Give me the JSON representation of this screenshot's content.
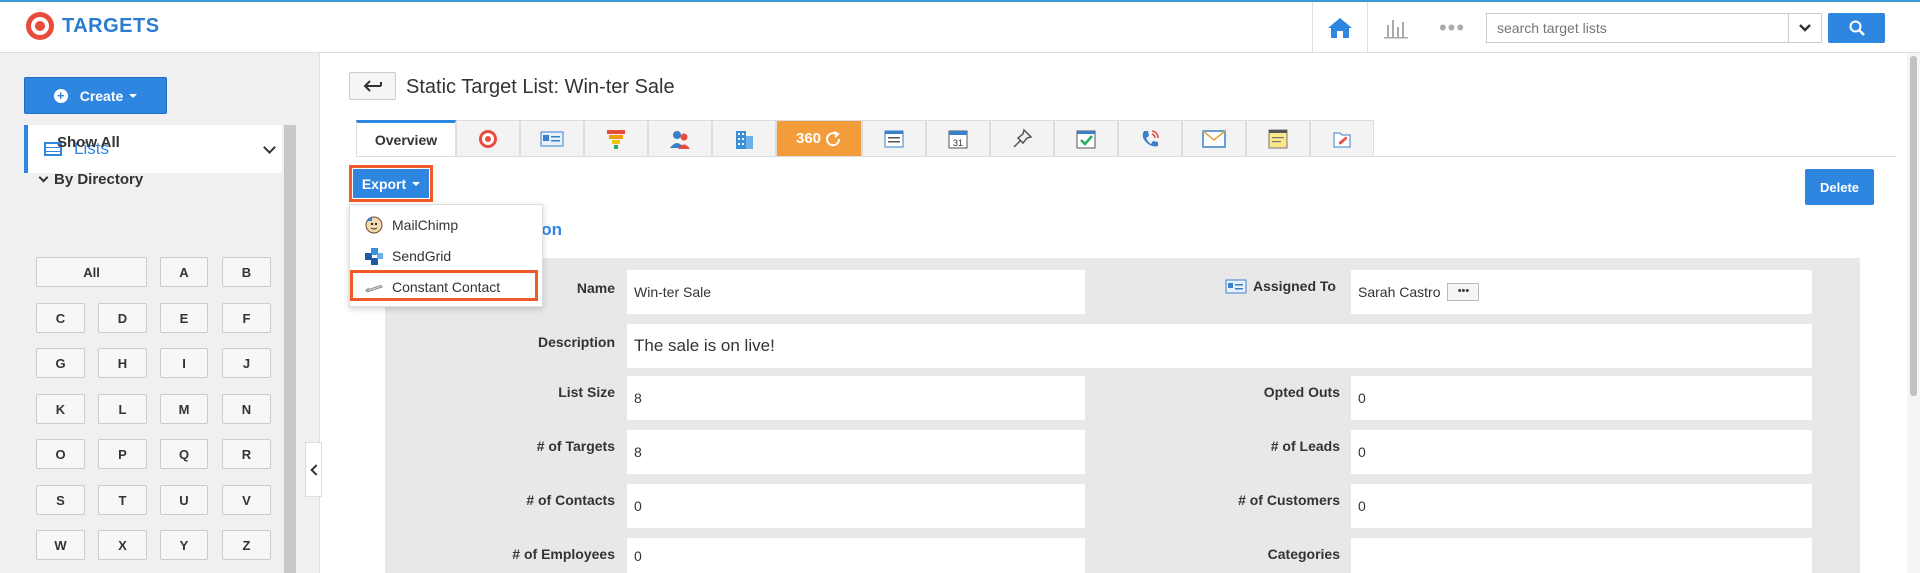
{
  "header": {
    "brand": "TARGETS",
    "search_placeholder": "search target lists",
    "more_label": "•••"
  },
  "sidebar": {
    "create_label": "Create",
    "lists_label": "Lists",
    "show_all": "Show All",
    "by_directory": "By Directory",
    "letters": [
      "All",
      "A",
      "B",
      "C",
      "D",
      "E",
      "F",
      "G",
      "H",
      "I",
      "J",
      "K",
      "L",
      "M",
      "N",
      "O",
      "P",
      "Q",
      "R",
      "S",
      "T",
      "U",
      "V",
      "W",
      "X",
      "Y",
      "Z"
    ]
  },
  "main": {
    "title": "Static Target List: Win-ter Sale",
    "tabs": [
      {
        "label": "Overview",
        "icon": "overview"
      },
      {
        "label": "",
        "icon": "target-icon"
      },
      {
        "label": "",
        "icon": "id-card-icon"
      },
      {
        "label": "",
        "icon": "funnel-icon"
      },
      {
        "label": "",
        "icon": "contacts-icon"
      },
      {
        "label": "",
        "icon": "building-icon"
      },
      {
        "label": "360",
        "icon": "360-icon"
      },
      {
        "label": "",
        "icon": "document-list-icon"
      },
      {
        "label": "31",
        "icon": "calendar-icon"
      },
      {
        "label": "",
        "icon": "pin-icon"
      },
      {
        "label": "",
        "icon": "task-check-icon"
      },
      {
        "label": "",
        "icon": "phone-icon"
      },
      {
        "label": "",
        "icon": "email-icon"
      },
      {
        "label": "",
        "icon": "note-icon"
      },
      {
        "label": "",
        "icon": "attachment-icon"
      }
    ],
    "export_label": "Export",
    "export_menu": [
      "MailChimp",
      "SendGrid",
      "Constant Contact"
    ],
    "delete_label": "Delete",
    "section_title": "nation"
  },
  "form": {
    "name": {
      "label": "Name",
      "value": "Win-ter Sale"
    },
    "assigned_to": {
      "label": "Assigned To",
      "value": "Sarah Castro"
    },
    "description": {
      "label": "Description",
      "value": "The sale is on live!"
    },
    "list_size": {
      "label": "List Size",
      "value": "8"
    },
    "opted_outs": {
      "label": "Opted Outs",
      "value": "0"
    },
    "num_targets": {
      "label": "# of Targets",
      "value": "8"
    },
    "num_leads": {
      "label": "# of Leads",
      "value": "0"
    },
    "num_contacts": {
      "label": "# of Contacts",
      "value": "0"
    },
    "num_customers": {
      "label": "# of Customers",
      "value": "0"
    },
    "num_employees": {
      "label": "# of Employees",
      "value": "0"
    },
    "categories": {
      "label": "Categories",
      "value": ""
    }
  },
  "colors": {
    "accent": "#2f86e0",
    "highlight_outline": "#f05a28",
    "tab_360": "#f39c3c"
  }
}
